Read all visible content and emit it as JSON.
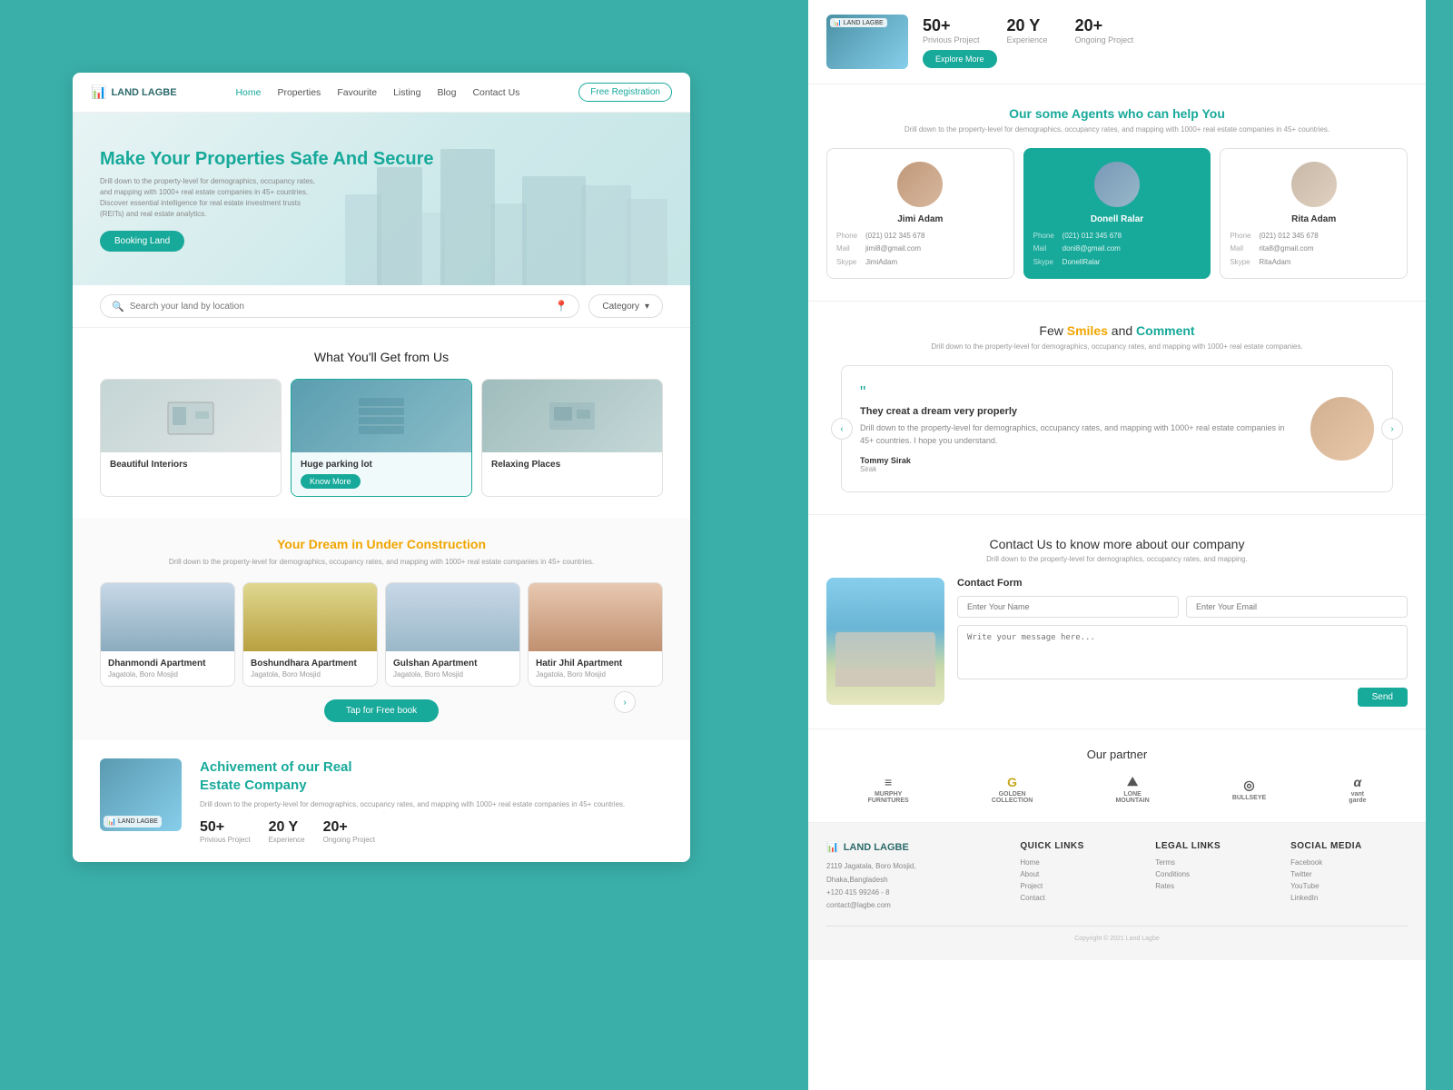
{
  "brand": {
    "name": "LAND LAGBE",
    "tagline": "LAND LAGBE"
  },
  "nav": {
    "links": [
      "Home",
      "Properties",
      "Favourite",
      "Listing",
      "Blog",
      "Contact Us"
    ],
    "active": "Home",
    "free_btn": "Free Registration"
  },
  "hero": {
    "title_pre": "Make Your ",
    "title_highlight": "Properties",
    "title_post": " Safe And Secure",
    "subtitle": "Drill down to the property-level for demographics, occupancy rates, and mapping with 1000+ real estate companies in 45+ countries. Discover essential intelligence for real estate investment trusts (REITs) and real estate analytics.",
    "cta": "Booking Land"
  },
  "search": {
    "placeholder": "Search your land by location",
    "category": "Category"
  },
  "features": {
    "section_title": "What You'll Get from Us",
    "items": [
      {
        "name": "Beautiful Interiors",
        "has_btn": false
      },
      {
        "name": "Huge parking lot",
        "has_btn": true,
        "btn_label": "Know More"
      },
      {
        "name": "Relaxing Places",
        "has_btn": false
      }
    ]
  },
  "dream": {
    "section_title_pre": "Your ",
    "section_title_highlight": "Dream",
    "section_title_post": " in Under Construction",
    "subtitle": "Drill down to the property-level for demographics, occupancy rates, and mapping with 1000+ real estate companies in 45+ countries.",
    "apartments": [
      {
        "name": "Dhanmondi Apartment",
        "location": "Jagatola, Boro Mosjid"
      },
      {
        "name": "Boshundhara Apartment",
        "location": "Jagatola, Boro Mosjid"
      },
      {
        "name": "Gulshan Apartment",
        "location": "Jagatola, Boro Mosjid"
      },
      {
        "name": "Hatir Jhil Apartment",
        "location": "Jagatola, Boro Mosjid"
      }
    ],
    "tap_btn": "Tap for Free book"
  },
  "achievement": {
    "title_pre": "Achivement ",
    "title_highlight": "of our Real",
    "title_post": " Estate Company",
    "subtitle": "Drill down to the property-level for demographics, occupancy rates, and mapping with 1000+ real estate companies in 45+ countries.",
    "stats": [
      {
        "num": "50+",
        "label": "Privious Project"
      },
      {
        "num": "20 Y",
        "label": "Experience"
      },
      {
        "num": "20+",
        "label": "Ongoing Project"
      }
    ],
    "img_badge": "LAND LAGBE"
  },
  "right_top": {
    "img_badge": "LAND LAGBE",
    "stats": [
      {
        "num": "50+",
        "label": "Privious Project"
      },
      {
        "num": "20 Y",
        "label": "Experience"
      },
      {
        "num": "20+",
        "label": "Ongoing Project"
      }
    ],
    "explore_btn": "Explore More"
  },
  "agents": {
    "title_pre": "Our some ",
    "title_highlight": "Agents",
    "title_post": " who can help You",
    "subtitle": "Drill down to the property-level for demographics, occupancy rates, and mapping with 1000+ real estate companies in 45+ countries.",
    "list": [
      {
        "name": "Jimi Adam",
        "phone": "(021) 012 345 678",
        "mail": "jimi8@gmail.com",
        "skype": "JimiAdam",
        "active": false
      },
      {
        "name": "Donell Ralar",
        "phone": "(021) 012 345 678",
        "mail": "doni8@gmail.com",
        "skype": "DonellRalar",
        "active": true
      },
      {
        "name": "Rita Adam",
        "phone": "(021) 012 345 678",
        "mail": "rita8@gmail.com",
        "skype": "RitaAdam",
        "active": false
      }
    ]
  },
  "testimonials": {
    "title_smiles": "Smiles",
    "title_comment": "Comment",
    "title_pre": "Few ",
    "title_mid": " and ",
    "subtitle": "Drill down to the property-level for demographics, occupancy rates, and mapping with 1000+ real estate companies.",
    "quote_heading": "They creat a dream very properly",
    "quote_text": "Drill down to the property-level for demographics, occupancy rates, and mapping with 1000+ real estate companies in 45+ countries. I hope you understand.",
    "author": "Tommy Sirak",
    "author_role": "Sirak"
  },
  "contact": {
    "title": "Contact Us to know more about our company",
    "subtitle": "Drill down to the property-level for demographics, occupancy rates, and mapping.",
    "form_title": "Contact Form",
    "name_placeholder": "Enter Your Name",
    "email_placeholder": "Enter Your Email",
    "message_placeholder": "Write your message here...",
    "send_btn": "Send"
  },
  "partners": {
    "title": "Our partner",
    "logos": [
      {
        "symbol": "≡≡",
        "name": "MURPHY\nFURNITURES"
      },
      {
        "symbol": "G",
        "name": "GOLDEN\nCOLLECTION"
      },
      {
        "symbol": "⛰",
        "name": "LONE\nMOUNTAIN"
      },
      {
        "symbol": "◎",
        "name": "BULLSEYE"
      },
      {
        "symbol": "α",
        "name": "vant\ngarde"
      }
    ]
  },
  "footer": {
    "brand": "LAND LAGBE",
    "address": "2119 Jagatala, Boro Mosjid,\nDhaka,Bangladesh",
    "phone": "+120 415 99246 - 8",
    "email": "contact@lagbe.com",
    "quick_links": {
      "title": "QUICK LINKS",
      "items": [
        "Home",
        "About",
        "Project",
        "Contact"
      ]
    },
    "legal_links": {
      "title": "LEGAL LINKS",
      "items": [
        "Terms",
        "Conditions",
        "Rates"
      ]
    },
    "social": {
      "title": "SOCIAL MEDIA",
      "items": [
        "Facebook",
        "Twitter",
        "YouTube",
        "LinkedIn"
      ]
    },
    "copyright": "Copyright © 2021 Land Lagbe"
  }
}
